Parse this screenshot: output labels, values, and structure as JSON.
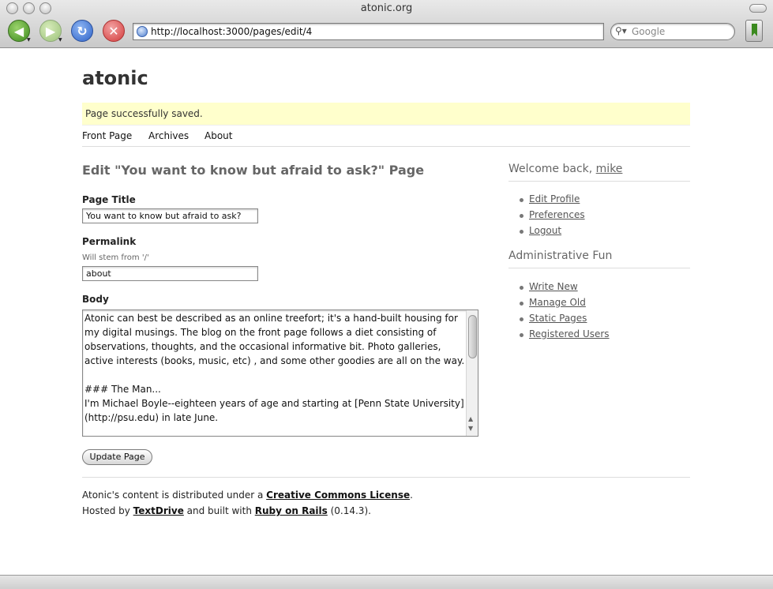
{
  "browser": {
    "window_title": "atonic.org",
    "url": "http://localhost:3000/pages/edit/4",
    "search_placeholder": "Google"
  },
  "site": {
    "title": "atonic",
    "flash": "Page successfully saved.",
    "nav": [
      "Front Page",
      "Archives",
      "About"
    ]
  },
  "form": {
    "heading": "Edit \"You want to know but afraid to ask?\" Page",
    "title_label": "Page Title",
    "title_value": "You want to know but afraid to ask?",
    "permalink_label": "Permalink",
    "permalink_hint": "Will stem from '/'",
    "permalink_value": "about",
    "body_label": "Body",
    "body_value": "Atonic can best be described as an online treefort; it's a hand-built housing for my digital musings. The blog on the front page follows a diet consisting of observations, thoughts, and the occasional informative bit. Photo galleries, active interests (books, music, etc) , and some other goodies are all on the way.\n\n### The Man...\nI'm Michael Boyle--eighteen years of age and starting at [Penn State University](http://psu.edu) in late June.",
    "submit_label": "Update Page"
  },
  "sidebar": {
    "welcome_prefix": "Welcome back, ",
    "username": "mike",
    "user_links": [
      "Edit Profile",
      "Preferences",
      "Logout"
    ],
    "admin_heading": "Administrative Fun",
    "admin_links": [
      "Write New",
      "Manage Old",
      "Static Pages",
      "Registered Users"
    ]
  },
  "footer": {
    "line1_prefix": "Atonic's content is distributed under a ",
    "license_link": "Creative Commons License",
    "line1_suffix": ".",
    "line2_prefix": "Hosted by ",
    "host_link": "TextDrive",
    "line2_middle": " and built with ",
    "rails_link": "Ruby on Rails",
    "line2_suffix": " (0.14.3)."
  }
}
